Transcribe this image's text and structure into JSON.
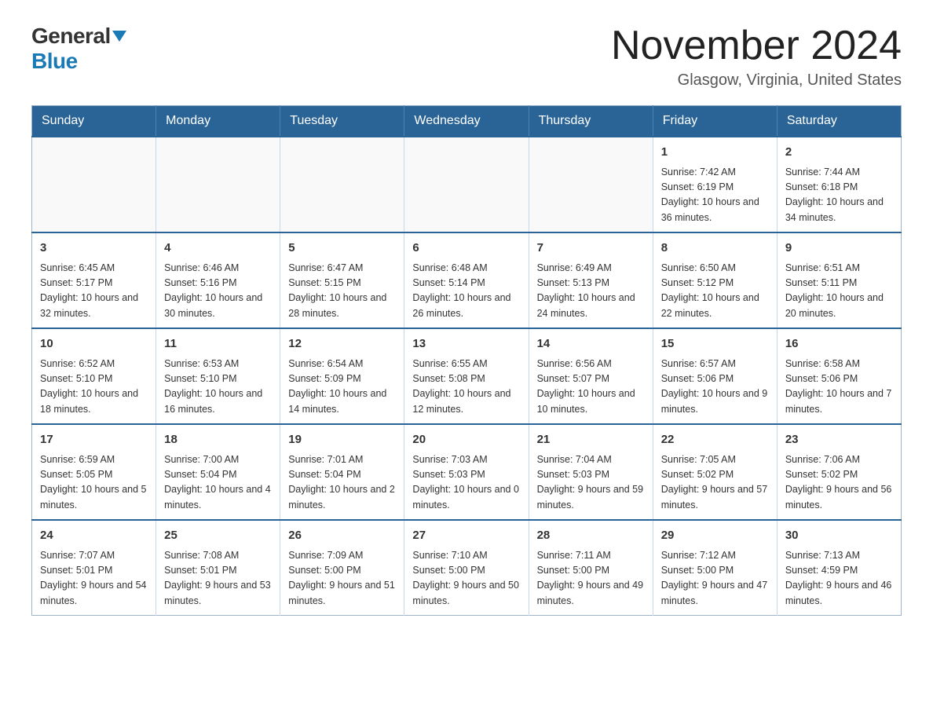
{
  "logo": {
    "general": "General",
    "blue": "Blue"
  },
  "header": {
    "title": "November 2024",
    "subtitle": "Glasgow, Virginia, United States"
  },
  "days_of_week": [
    "Sunday",
    "Monday",
    "Tuesday",
    "Wednesday",
    "Thursday",
    "Friday",
    "Saturday"
  ],
  "weeks": [
    [
      {
        "day": "",
        "info": ""
      },
      {
        "day": "",
        "info": ""
      },
      {
        "day": "",
        "info": ""
      },
      {
        "day": "",
        "info": ""
      },
      {
        "day": "",
        "info": ""
      },
      {
        "day": "1",
        "info": "Sunrise: 7:42 AM\nSunset: 6:19 PM\nDaylight: 10 hours and 36 minutes."
      },
      {
        "day": "2",
        "info": "Sunrise: 7:44 AM\nSunset: 6:18 PM\nDaylight: 10 hours and 34 minutes."
      }
    ],
    [
      {
        "day": "3",
        "info": "Sunrise: 6:45 AM\nSunset: 5:17 PM\nDaylight: 10 hours and 32 minutes."
      },
      {
        "day": "4",
        "info": "Sunrise: 6:46 AM\nSunset: 5:16 PM\nDaylight: 10 hours and 30 minutes."
      },
      {
        "day": "5",
        "info": "Sunrise: 6:47 AM\nSunset: 5:15 PM\nDaylight: 10 hours and 28 minutes."
      },
      {
        "day": "6",
        "info": "Sunrise: 6:48 AM\nSunset: 5:14 PM\nDaylight: 10 hours and 26 minutes."
      },
      {
        "day": "7",
        "info": "Sunrise: 6:49 AM\nSunset: 5:13 PM\nDaylight: 10 hours and 24 minutes."
      },
      {
        "day": "8",
        "info": "Sunrise: 6:50 AM\nSunset: 5:12 PM\nDaylight: 10 hours and 22 minutes."
      },
      {
        "day": "9",
        "info": "Sunrise: 6:51 AM\nSunset: 5:11 PM\nDaylight: 10 hours and 20 minutes."
      }
    ],
    [
      {
        "day": "10",
        "info": "Sunrise: 6:52 AM\nSunset: 5:10 PM\nDaylight: 10 hours and 18 minutes."
      },
      {
        "day": "11",
        "info": "Sunrise: 6:53 AM\nSunset: 5:10 PM\nDaylight: 10 hours and 16 minutes."
      },
      {
        "day": "12",
        "info": "Sunrise: 6:54 AM\nSunset: 5:09 PM\nDaylight: 10 hours and 14 minutes."
      },
      {
        "day": "13",
        "info": "Sunrise: 6:55 AM\nSunset: 5:08 PM\nDaylight: 10 hours and 12 minutes."
      },
      {
        "day": "14",
        "info": "Sunrise: 6:56 AM\nSunset: 5:07 PM\nDaylight: 10 hours and 10 minutes."
      },
      {
        "day": "15",
        "info": "Sunrise: 6:57 AM\nSunset: 5:06 PM\nDaylight: 10 hours and 9 minutes."
      },
      {
        "day": "16",
        "info": "Sunrise: 6:58 AM\nSunset: 5:06 PM\nDaylight: 10 hours and 7 minutes."
      }
    ],
    [
      {
        "day": "17",
        "info": "Sunrise: 6:59 AM\nSunset: 5:05 PM\nDaylight: 10 hours and 5 minutes."
      },
      {
        "day": "18",
        "info": "Sunrise: 7:00 AM\nSunset: 5:04 PM\nDaylight: 10 hours and 4 minutes."
      },
      {
        "day": "19",
        "info": "Sunrise: 7:01 AM\nSunset: 5:04 PM\nDaylight: 10 hours and 2 minutes."
      },
      {
        "day": "20",
        "info": "Sunrise: 7:03 AM\nSunset: 5:03 PM\nDaylight: 10 hours and 0 minutes."
      },
      {
        "day": "21",
        "info": "Sunrise: 7:04 AM\nSunset: 5:03 PM\nDaylight: 9 hours and 59 minutes."
      },
      {
        "day": "22",
        "info": "Sunrise: 7:05 AM\nSunset: 5:02 PM\nDaylight: 9 hours and 57 minutes."
      },
      {
        "day": "23",
        "info": "Sunrise: 7:06 AM\nSunset: 5:02 PM\nDaylight: 9 hours and 56 minutes."
      }
    ],
    [
      {
        "day": "24",
        "info": "Sunrise: 7:07 AM\nSunset: 5:01 PM\nDaylight: 9 hours and 54 minutes."
      },
      {
        "day": "25",
        "info": "Sunrise: 7:08 AM\nSunset: 5:01 PM\nDaylight: 9 hours and 53 minutes."
      },
      {
        "day": "26",
        "info": "Sunrise: 7:09 AM\nSunset: 5:00 PM\nDaylight: 9 hours and 51 minutes."
      },
      {
        "day": "27",
        "info": "Sunrise: 7:10 AM\nSunset: 5:00 PM\nDaylight: 9 hours and 50 minutes."
      },
      {
        "day": "28",
        "info": "Sunrise: 7:11 AM\nSunset: 5:00 PM\nDaylight: 9 hours and 49 minutes."
      },
      {
        "day": "29",
        "info": "Sunrise: 7:12 AM\nSunset: 5:00 PM\nDaylight: 9 hours and 47 minutes."
      },
      {
        "day": "30",
        "info": "Sunrise: 7:13 AM\nSunset: 4:59 PM\nDaylight: 9 hours and 46 minutes."
      }
    ]
  ]
}
